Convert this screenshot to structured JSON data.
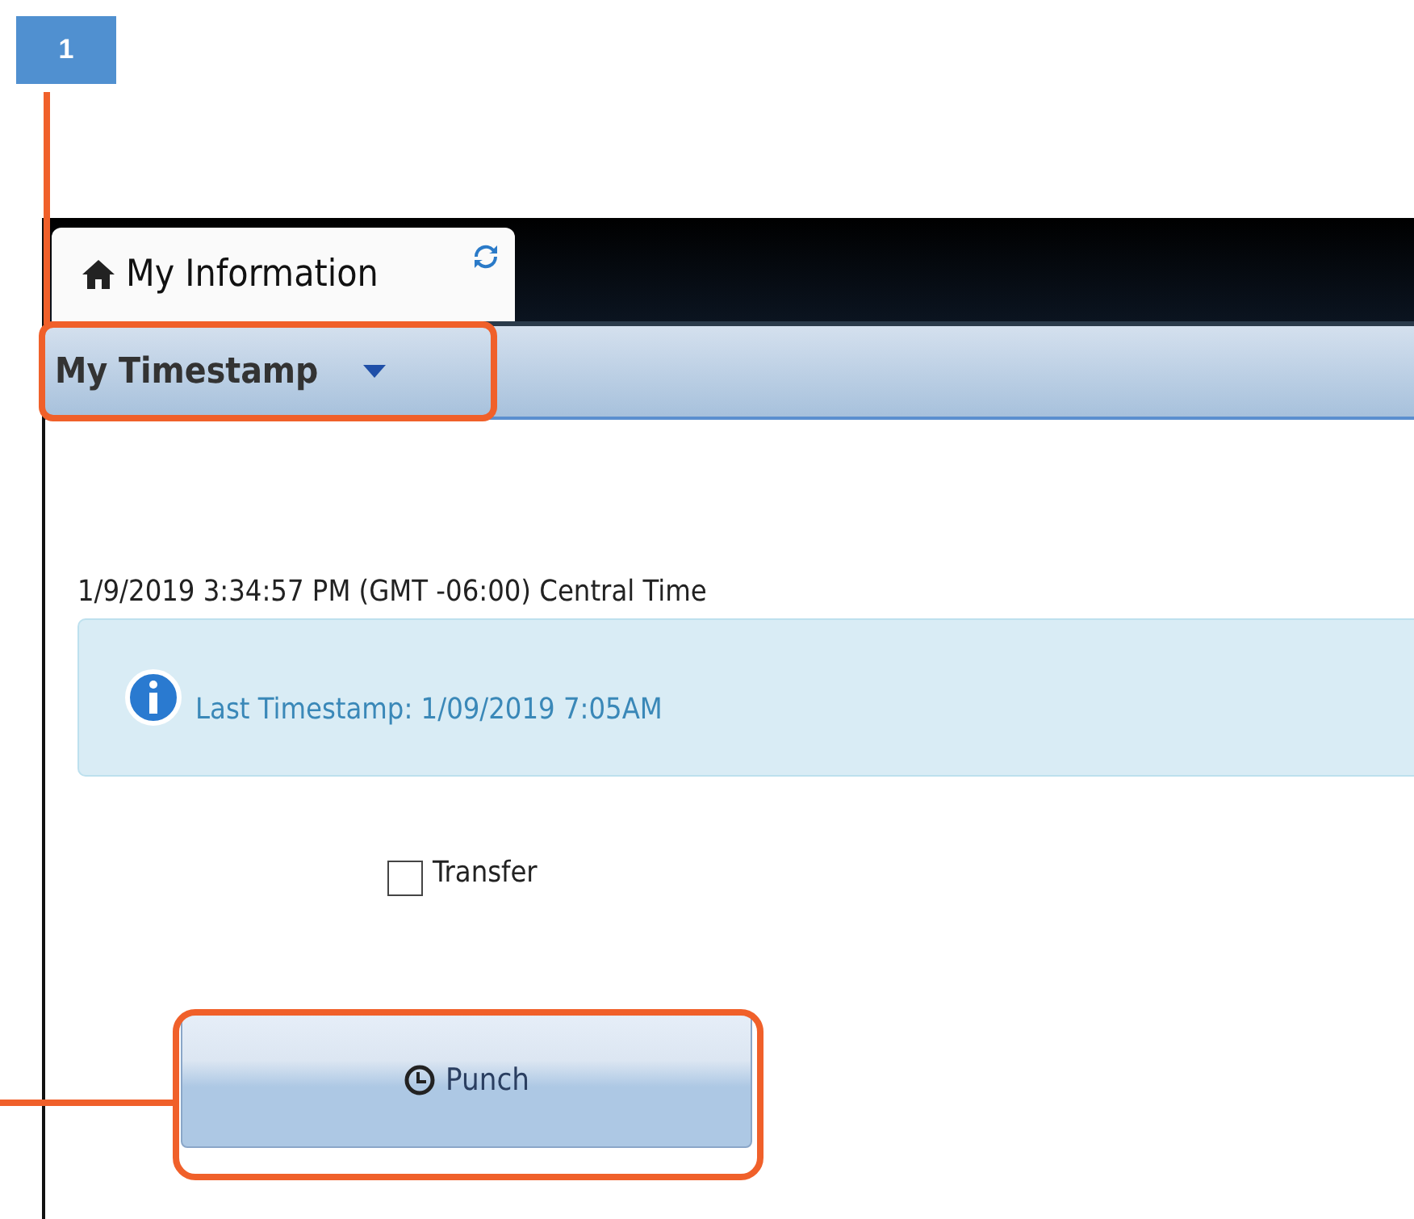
{
  "callout": {
    "number": "1"
  },
  "tabs": [
    {
      "label": "My Information",
      "selected": true
    }
  ],
  "section": {
    "title": "My Timestamp"
  },
  "clock": "1/9/2019 3:34:57 PM (GMT -06:00) Central Time",
  "info": {
    "message": "Last Timestamp: 1/09/2019 7:05AM"
  },
  "transfer": {
    "label": "Transfer",
    "checked": false
  },
  "punch": {
    "label": "Punch"
  }
}
